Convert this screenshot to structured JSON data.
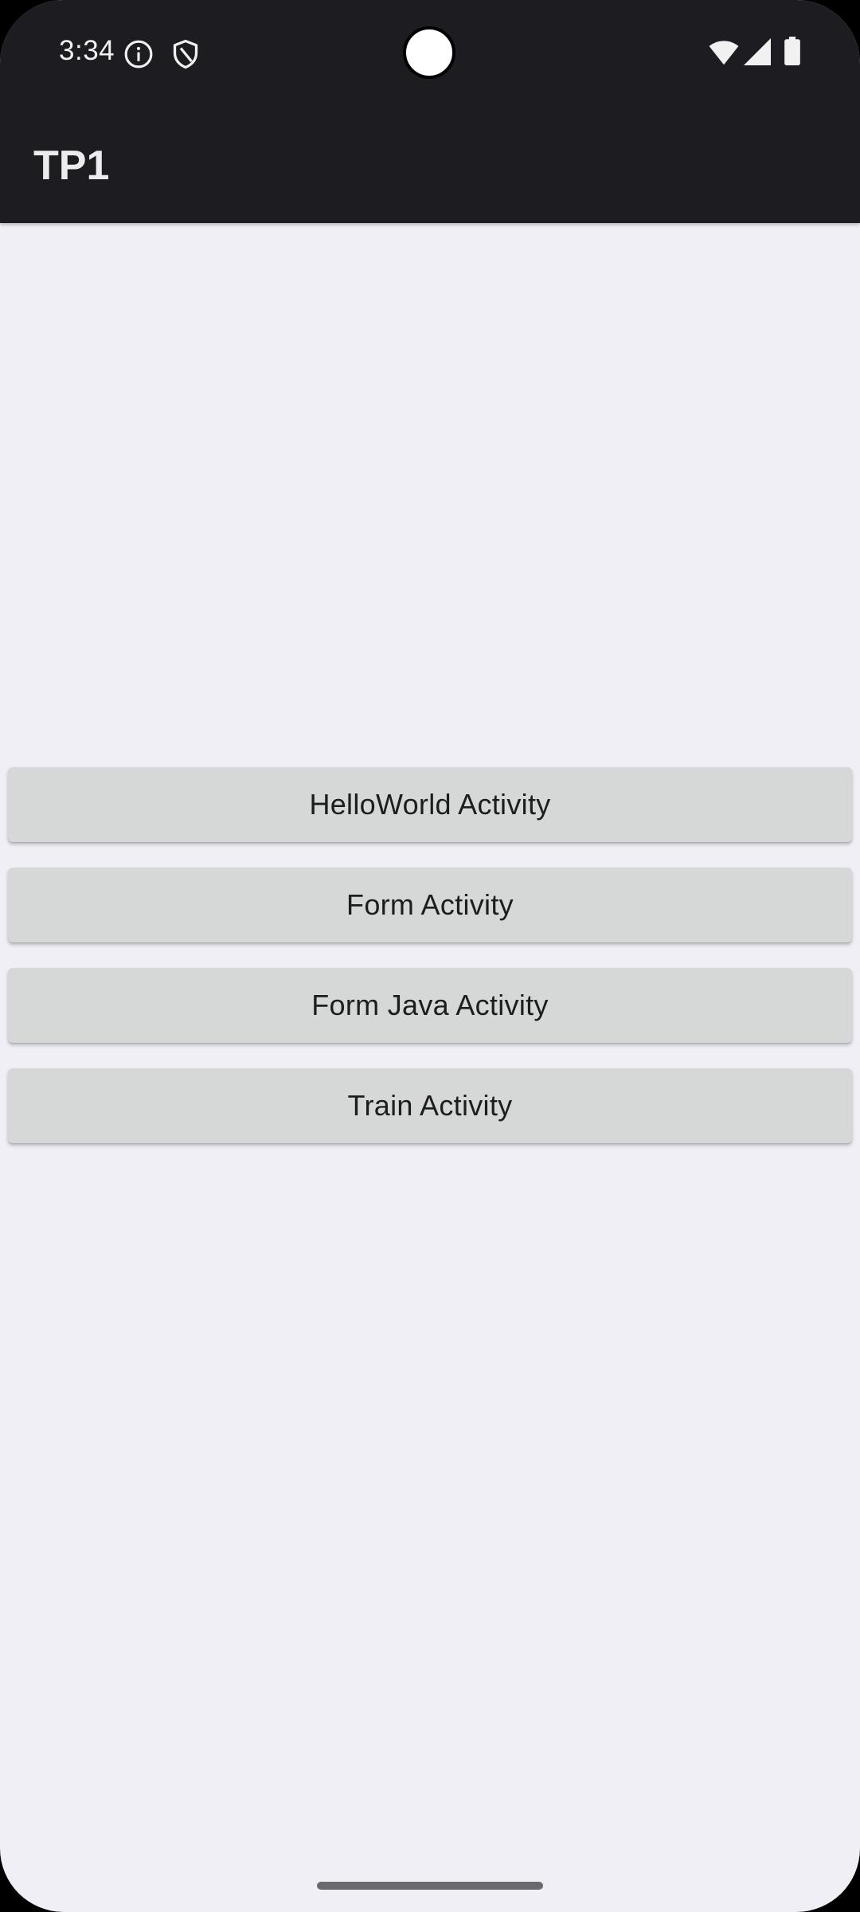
{
  "status_bar": {
    "time": "3:34",
    "icons": [
      "info-icon",
      "shield-icon",
      "wifi-icon",
      "signal-icon",
      "battery-icon"
    ]
  },
  "app_bar": {
    "title": "TP1"
  },
  "buttons": [
    {
      "label": "HelloWorld Activity"
    },
    {
      "label": "Form Activity"
    },
    {
      "label": "Form Java Activity"
    },
    {
      "label": "Train Activity"
    }
  ],
  "colors": {
    "bars": "#1c1c21",
    "background": "#efeff5",
    "button": "#d6d7d7"
  }
}
